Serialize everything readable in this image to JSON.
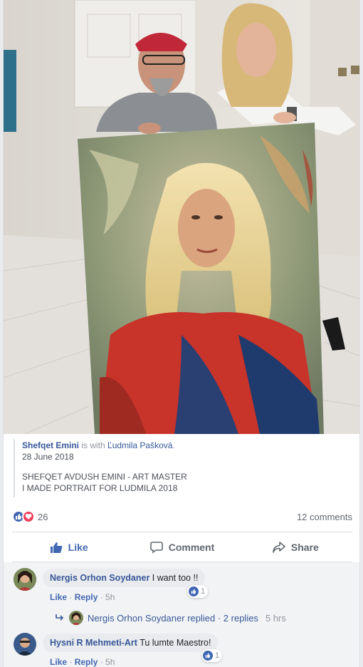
{
  "post": {
    "author": "Shefqet Emini",
    "with_text": "is with",
    "tagged": "Ľudmila Pašková",
    "date": "28 June 2018",
    "body_line1": "SHEFQET AVDUSH EMINI - ART MASTER",
    "body_line2": "I MADE PORTRAIT FOR LUDMILA 2018"
  },
  "reactions": {
    "count": "26",
    "comments_count": "12 comments"
  },
  "actions": {
    "like": "Like",
    "comment": "Comment",
    "share": "Share"
  },
  "comments": [
    {
      "name": "Nergis Orhon Soydaner",
      "text": "I want too !!",
      "like": "Like",
      "reply": "Reply",
      "time": "5h",
      "reactions": "1"
    },
    {
      "name": "Hysni R Mehmeti-Art",
      "text": "Tu lumte Maestro!",
      "like": "Like",
      "reply": "Reply",
      "time": "5h",
      "reactions": "1"
    }
  ],
  "replies": {
    "name": "Nergis Orhon Soydaner",
    "verb": "replied",
    "count": "2 replies",
    "time": "5 hrs"
  },
  "colors": {
    "accent": "#4267b2",
    "link": "#365899",
    "love": "#f33e58"
  }
}
